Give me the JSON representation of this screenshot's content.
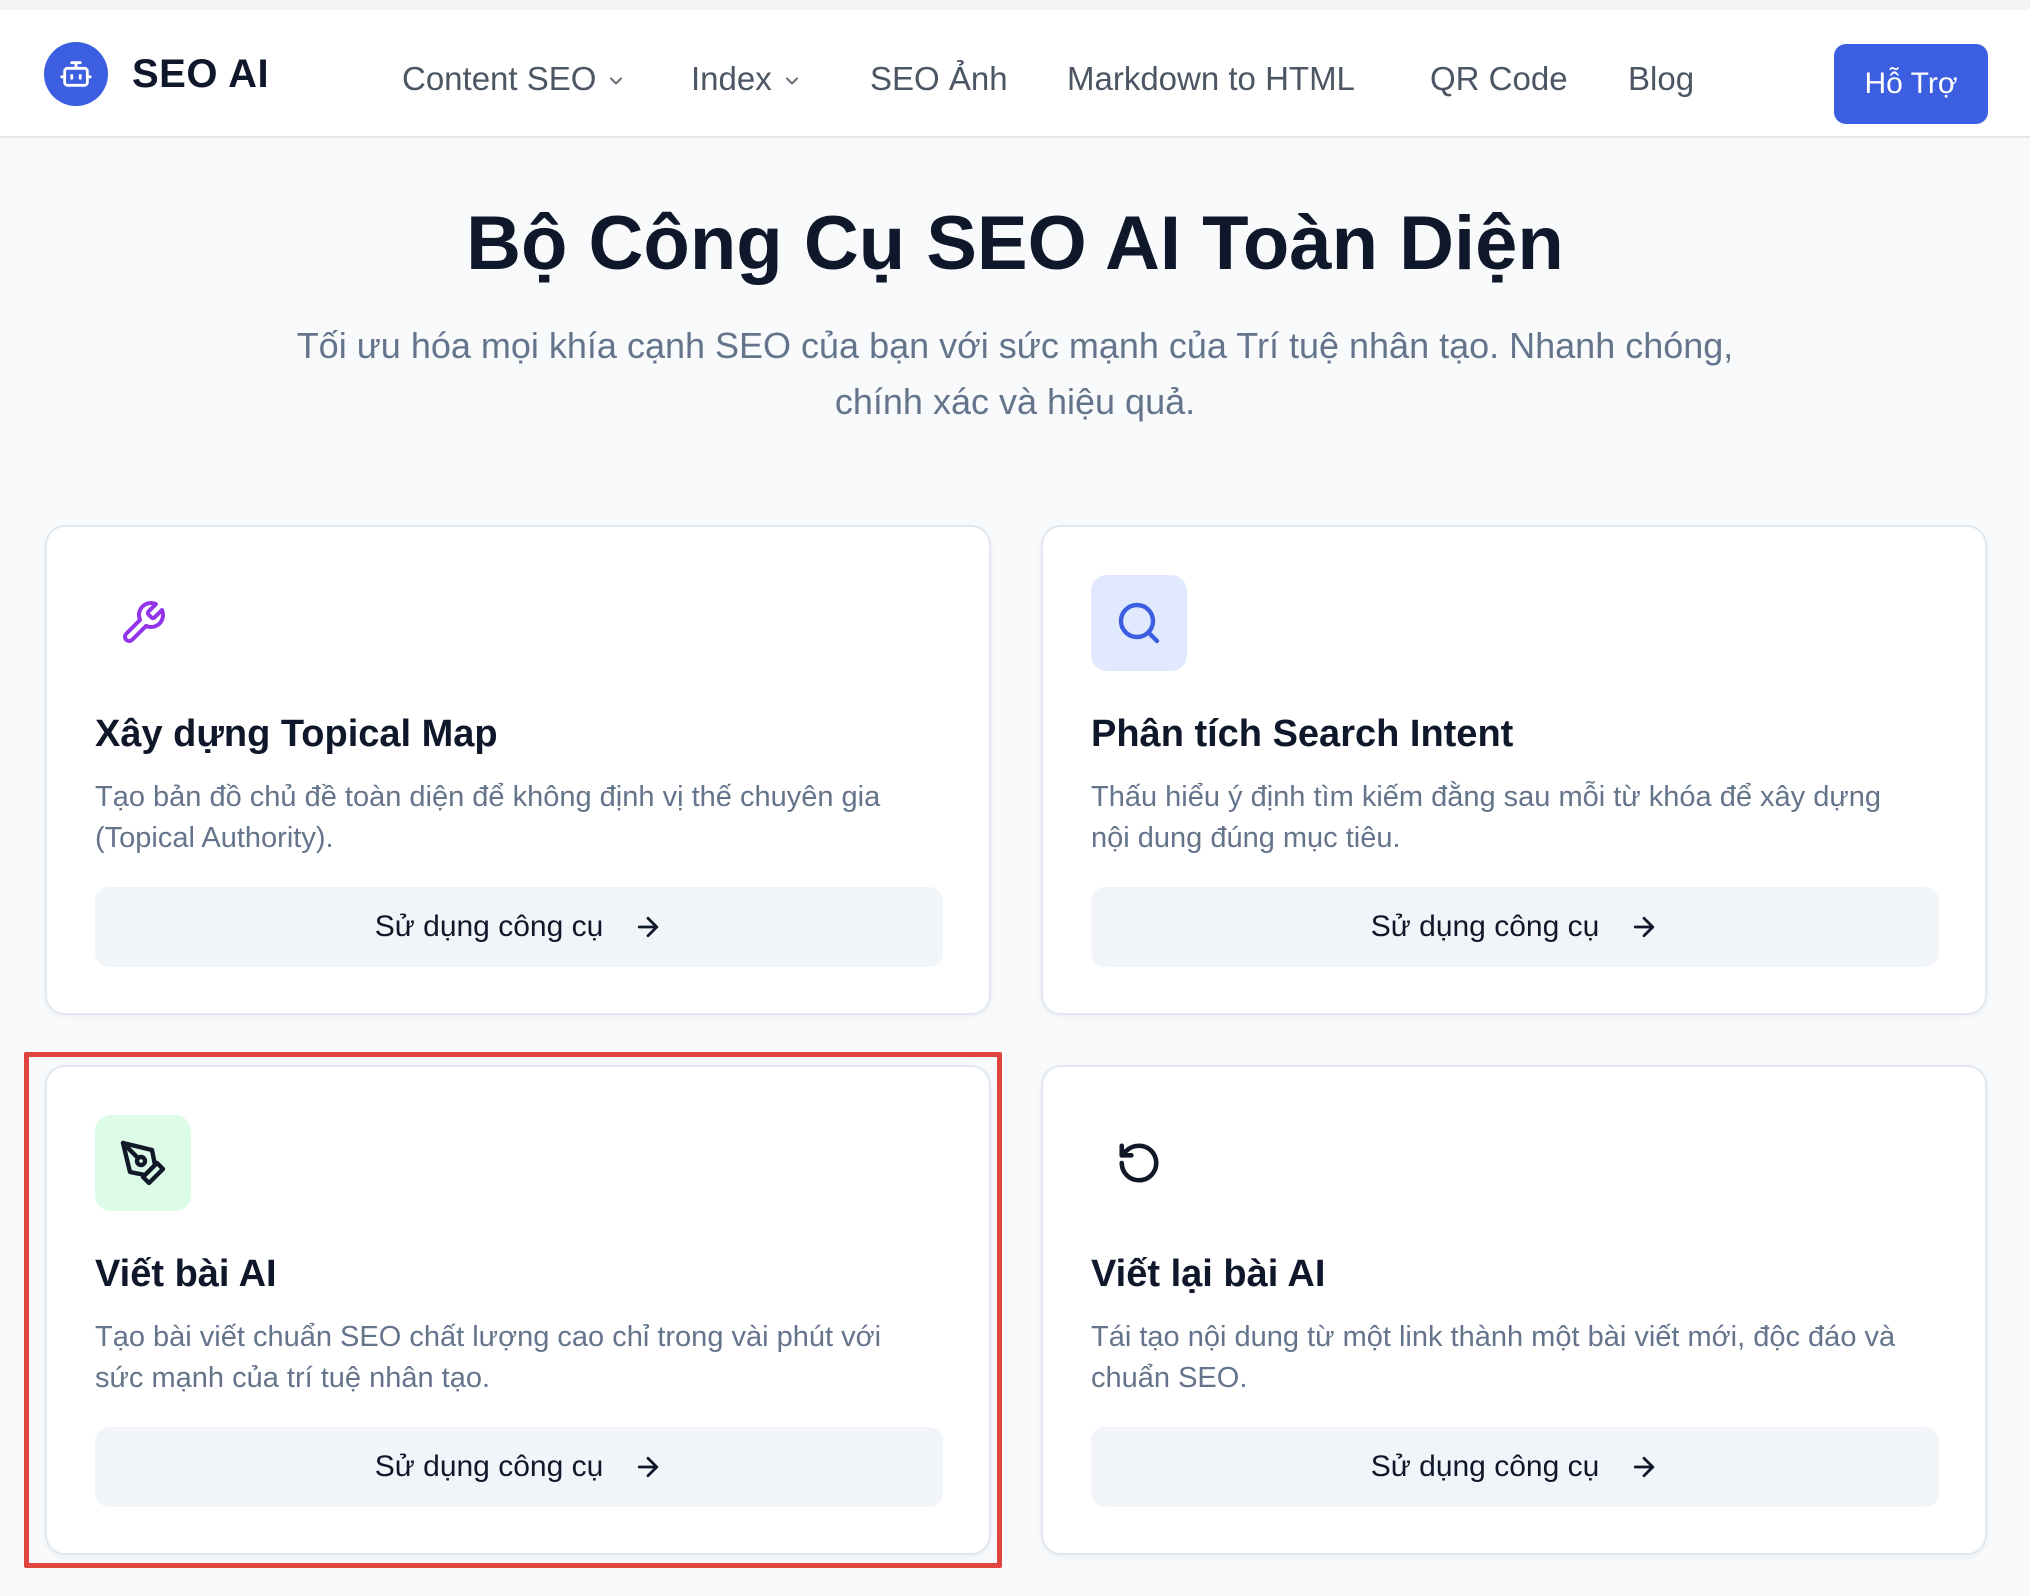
{
  "header": {
    "logo_text": "SEO AI",
    "logo_icon": "robot-icon",
    "nav": [
      {
        "label": "Content SEO",
        "dropdown": true
      },
      {
        "label": "Index",
        "dropdown": true
      },
      {
        "label": "SEO Ảnh",
        "dropdown": false
      },
      {
        "label": "Markdown to HTML",
        "dropdown": false
      },
      {
        "label": "QR Code",
        "dropdown": false
      },
      {
        "label": "Blog",
        "dropdown": false
      }
    ],
    "support_label": "Hỗ Trợ"
  },
  "hero": {
    "title": "Bộ Công Cụ SEO AI Toàn Diện",
    "subtitle_line1": "Tối ưu hóa mọi khía cạnh SEO của bạn với sức mạnh của Trí tuệ nhân tạo. Nhanh chóng,",
    "subtitle_line2": "chính xác và hiệu quả."
  },
  "cards": [
    {
      "title": "Xây dựng Topical Map",
      "desc_line1": "Tạo bản đồ chủ đề toàn diện để không định vị thế chuyên gia",
      "desc_line2": "(Topical Authority).",
      "button_label": "Sử dụng công cụ",
      "icon": "wrench-icon",
      "icon_color": "#9333ea",
      "icon_bg": "#ffffff"
    },
    {
      "title": "Phân tích Search Intent",
      "desc_line1": "Thấu hiểu ý định tìm kiếm đằng sau mỗi từ khóa để xây dựng",
      "desc_line2": "nội dung đúng mục tiêu.",
      "button_label": "Sử dụng công cụ",
      "icon": "search-icon",
      "icon_color": "#3b5fe0",
      "icon_bg": "#e0e9fd"
    },
    {
      "title": "Viết bài AI",
      "desc_line1": "Tạo bài viết chuẩn SEO chất lượng cao chỉ trong vài phút với",
      "desc_line2": "sức mạnh của trí tuệ nhân tạo.",
      "button_label": "Sử dụng công cụ",
      "icon": "pen-tool-icon",
      "icon_color": "#111827",
      "icon_bg": "#dcfce7"
    },
    {
      "title": "Viết lại bài AI",
      "desc_line1": "Tái tạo nội dung từ một link thành một bài viết mới, độc đáo và",
      "desc_line2": "chuẩn SEO.",
      "button_label": "Sử dụng công cụ",
      "icon": "rotate-ccw-icon",
      "icon_color": "#111827",
      "icon_bg": "#ffffff"
    }
  ],
  "colors": {
    "primary": "#3b5fe0",
    "highlight_border": "#e0443e",
    "page_bg": "#f8fafc"
  }
}
